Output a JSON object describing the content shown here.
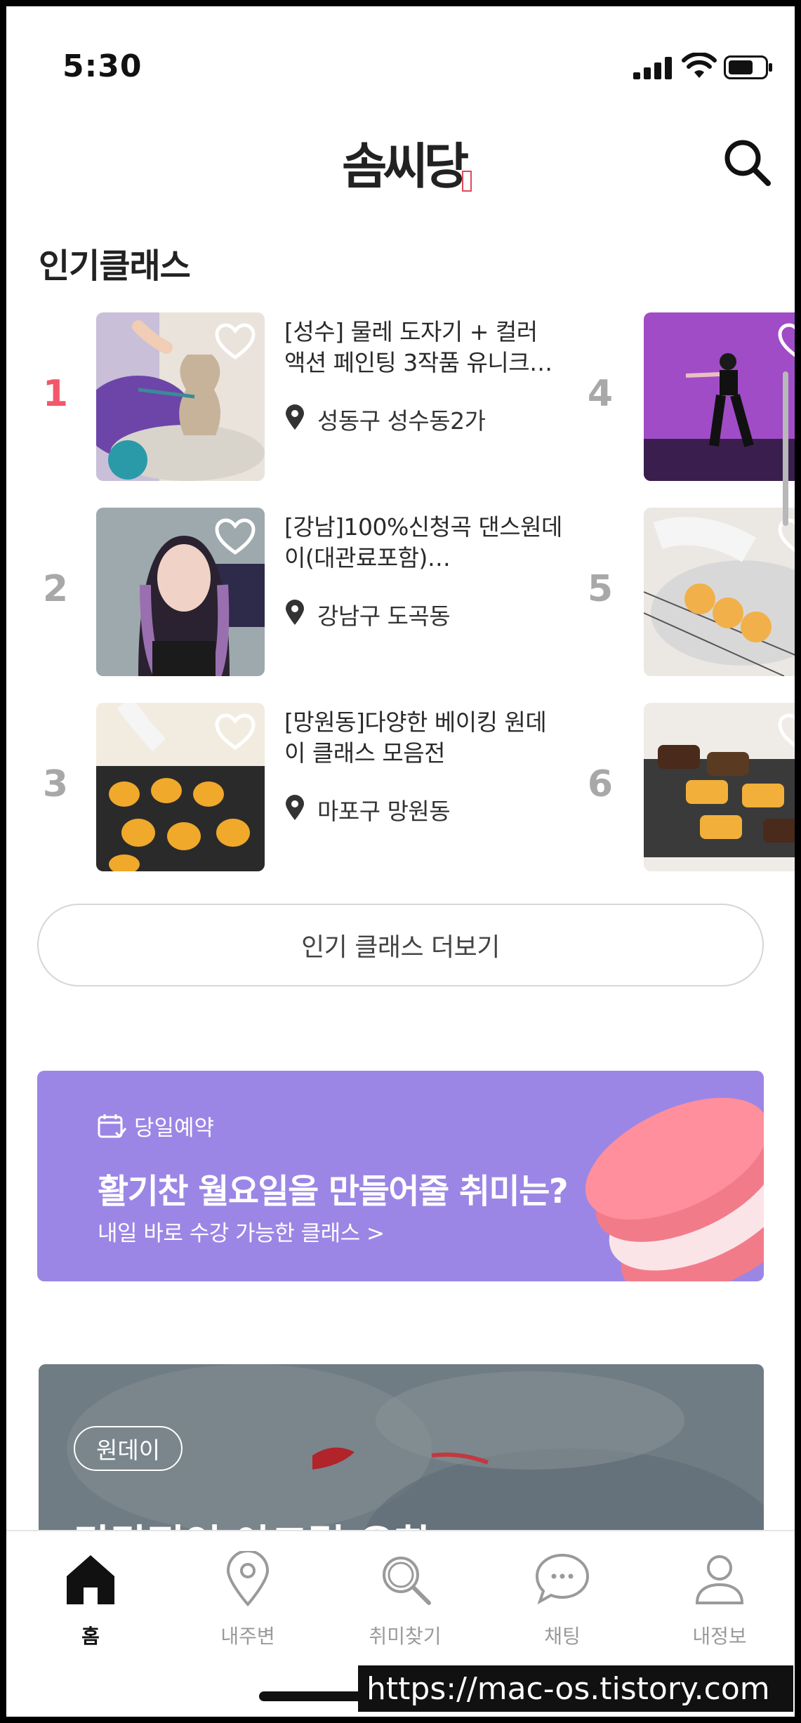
{
  "status": {
    "time": "5:30"
  },
  "header": {
    "logo_text": "솜씨당"
  },
  "popular": {
    "title": "인기클래스",
    "items": [
      {
        "rank": "1",
        "title": "[성수] 물레 도자기 + 컬러 액션 페인팅 3작품 유니크…",
        "location": "성동구 성수동2가"
      },
      {
        "rank": "2",
        "title": "[강남]100%신청곡 댄스원데이(대관료포함)…",
        "location": "강남구 도곡동"
      },
      {
        "rank": "3",
        "title": "[망원동]다양한 베이킹 원데이 클래스 모음전",
        "location": "마포구 망원동"
      },
      {
        "rank": "4"
      },
      {
        "rank": "5"
      },
      {
        "rank": "6"
      }
    ],
    "more_label": "인기 클래스 더보기"
  },
  "banner": {
    "tag": "당일예약",
    "title": "활기찬 월요일을 만들어줄 취미는?",
    "subtitle": "내일 바로 수강 가능한 클래스 >"
  },
  "feature": {
    "badge": "원데이",
    "title": "감각적인 아크릴 유화"
  },
  "tabs": [
    {
      "label": "홈",
      "icon": "home-icon",
      "active": true
    },
    {
      "label": "내주변",
      "icon": "location-pin-icon"
    },
    {
      "label": "취미찾기",
      "icon": "search-icon"
    },
    {
      "label": "채팅",
      "icon": "chat-bubble-icon"
    },
    {
      "label": "내정보",
      "icon": "person-icon"
    }
  ],
  "colors": {
    "accent": "#f2586a",
    "banner": "#9b86e6"
  },
  "watermark": "https://mac-os.tistory.com"
}
